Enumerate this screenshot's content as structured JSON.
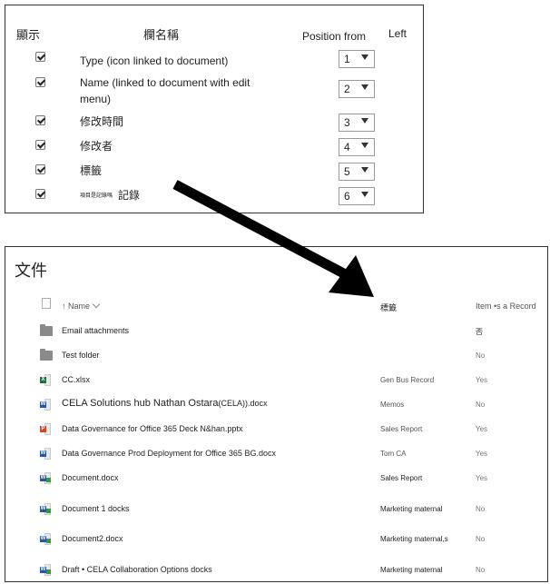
{
  "settings_panel": {
    "headers": {
      "show": "顯示",
      "column_name": "欄名稱",
      "position_from": "Position from",
      "left": "Left"
    },
    "rows": [
      {
        "checked": true,
        "label": "Type (icon linked to document)",
        "position": "1"
      },
      {
        "checked": true,
        "label": "Name (linked to document with edit",
        "label_line2": "menu)",
        "position": "2"
      },
      {
        "checked": true,
        "label": "修改時間",
        "position": "3"
      },
      {
        "checked": true,
        "label": "修改者",
        "position": "4"
      },
      {
        "checked": true,
        "label": "標籤",
        "position": "5"
      },
      {
        "checked": true,
        "label_small": "項目是記錄嗎",
        "label": "記錄",
        "position": "6"
      }
    ]
  },
  "library": {
    "title": "文件",
    "columns": {
      "name": "Name",
      "tag": "標籤",
      "record": "Item •s a Record"
    },
    "items": [
      {
        "icon": "folder-icon",
        "name": "Email attachments",
        "tag": "",
        "record": "否"
      },
      {
        "icon": "folder-icon",
        "name": "Test folder",
        "tag": "",
        "record": "No"
      },
      {
        "icon": "excel-file-icon",
        "name": "CC.xlsx",
        "tag": "Gen Bus Record",
        "record": "Yes"
      },
      {
        "icon": "word-file-icon",
        "name": "CELA Solutions hub Nathan Ostara",
        "name_suffix": "(CELA)).docx",
        "tag": "Memos",
        "record": "No"
      },
      {
        "icon": "powerpoint-file-icon",
        "name": "Data Governance for Office 365 Deck N&han.pptx",
        "tag": "Sales Report",
        "record": "Yes"
      },
      {
        "icon": "word-file-icon",
        "name": "Data Governance Prod Deployment for Office 365 BG.docx",
        "tag": "Tom CA",
        "record": "Yes"
      },
      {
        "icon": "word-record-icon",
        "name": "Document.docx",
        "tag": "Sales Report",
        "record": "Yes"
      },
      {
        "icon": "word-record-icon",
        "name": "Document 1 docks",
        "tag": "Marketing maternal",
        "record": "No"
      },
      {
        "icon": "word-record-icon",
        "name": "Document2.docx",
        "tag": "Marketing maternal,s",
        "record": "No"
      },
      {
        "icon": "word-record-icon",
        "name": "Draft • CELA Collaboration Options docks",
        "tag": "Marketing maternal",
        "record": "No"
      }
    ]
  },
  "colors": {
    "excel": "#1e7145",
    "word": "#2b579a",
    "powerpoint": "#d24726",
    "record_badge": "#2e9e3c",
    "arrow": "#000000"
  }
}
